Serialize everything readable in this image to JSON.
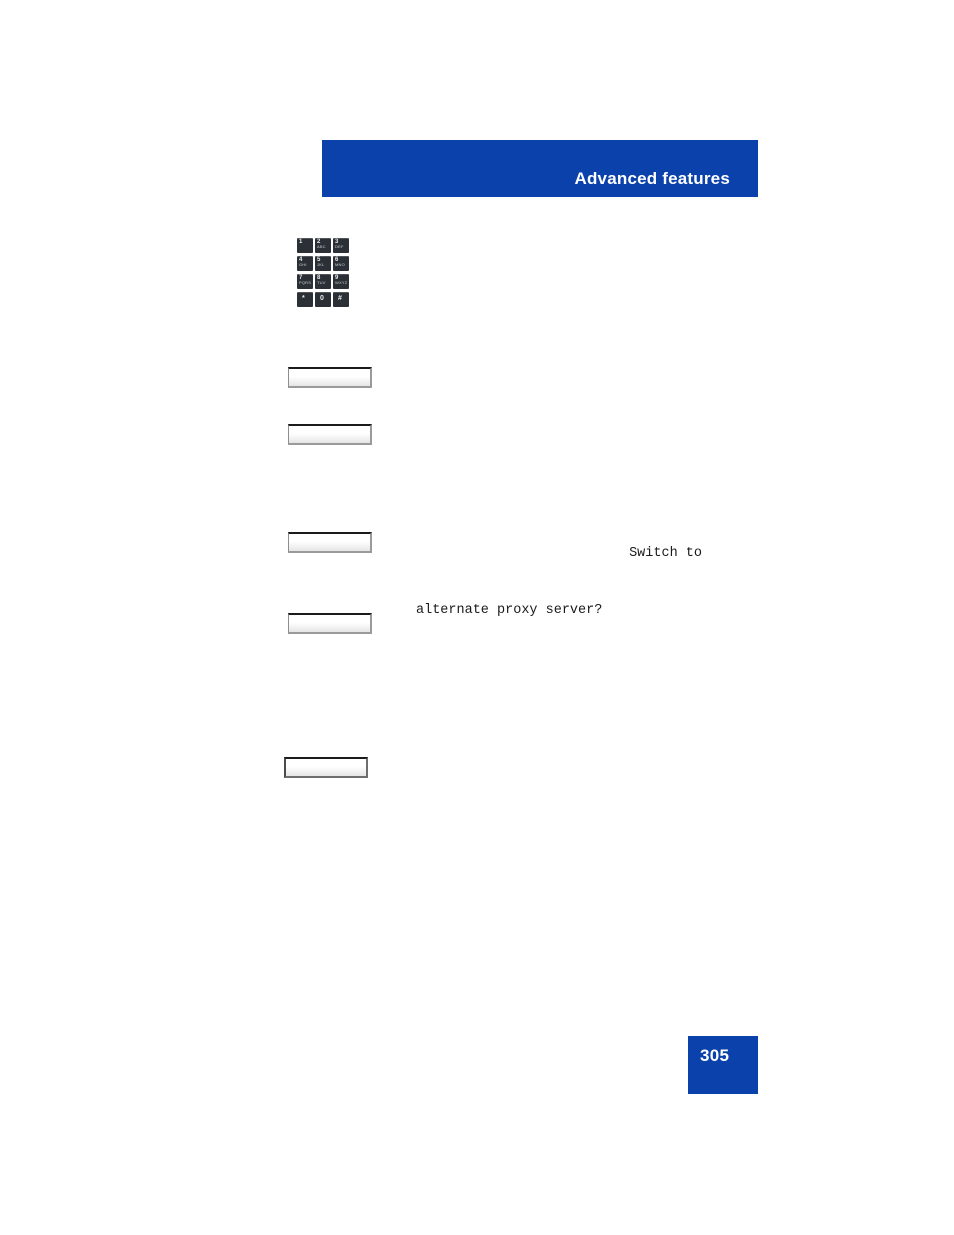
{
  "header": {
    "title": "Advanced features",
    "background_color": "#0b41ab",
    "text_color": "#ffffff"
  },
  "keypad": {
    "icon_name": "dialpad-icon",
    "keys": [
      {
        "digit": "1",
        "letters": ""
      },
      {
        "digit": "2",
        "letters": "ABC"
      },
      {
        "digit": "3",
        "letters": "DEF"
      },
      {
        "digit": "4",
        "letters": "GHI"
      },
      {
        "digit": "5",
        "letters": "JKL"
      },
      {
        "digit": "6",
        "letters": "MNO"
      },
      {
        "digit": "7",
        "letters": "PQRS"
      },
      {
        "digit": "8",
        "letters": "TUV"
      },
      {
        "digit": "9",
        "letters": "WXYZ"
      },
      {
        "digit": "*",
        "letters": ""
      },
      {
        "digit": "0",
        "letters": ""
      },
      {
        "digit": "#",
        "letters": ""
      }
    ]
  },
  "softkeys": [
    {
      "id": "softkey-1",
      "label": ""
    },
    {
      "id": "softkey-2",
      "label": ""
    },
    {
      "id": "softkey-3",
      "label": ""
    },
    {
      "id": "softkey-4",
      "label": ""
    },
    {
      "id": "softkey-5",
      "label": ""
    }
  ],
  "display": {
    "line_1": "Switch to",
    "line_2": "alternate proxy server?"
  },
  "footer": {
    "page_number": "305",
    "badge_color": "#0b41ab",
    "text_color": "#ffffff"
  }
}
